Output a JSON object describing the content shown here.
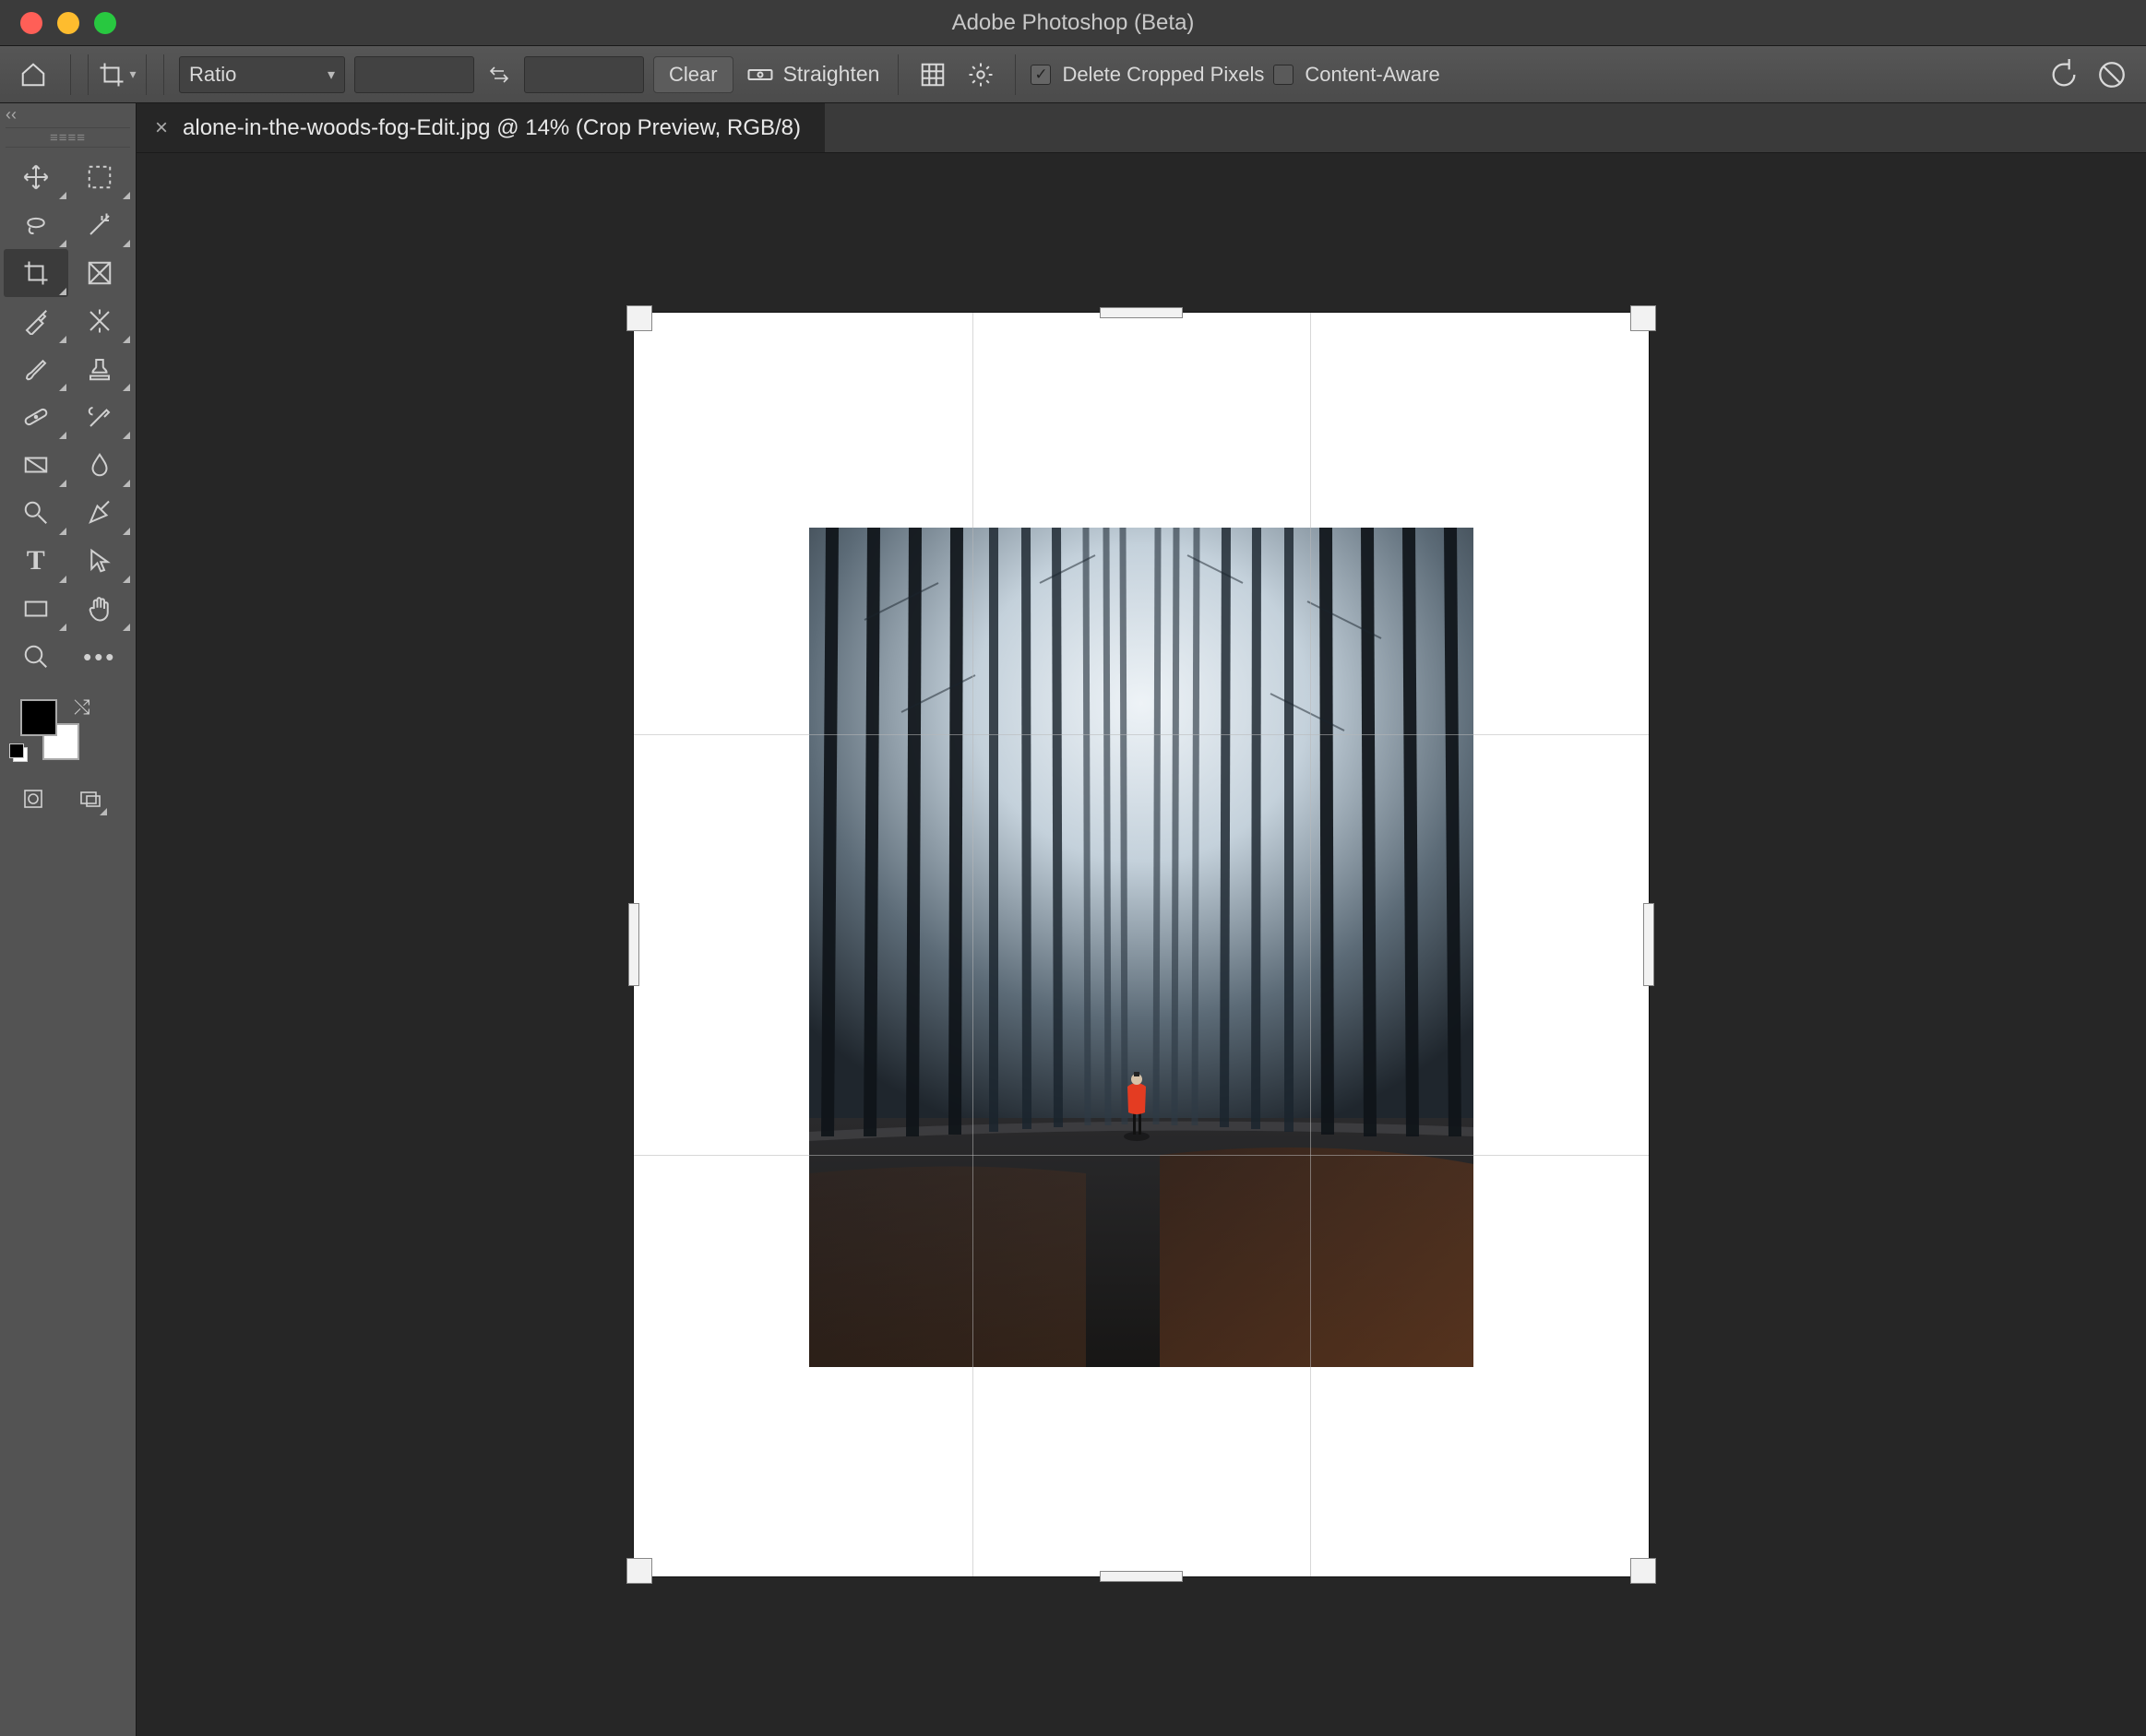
{
  "app_title": "Adobe Photoshop (Beta)",
  "options": {
    "ratio_label": "Ratio",
    "width_value": "",
    "height_value": "",
    "clear_label": "Clear",
    "straighten_label": "Straighten",
    "delete_cropped_label": "Delete Cropped Pixels",
    "delete_cropped_checked": true,
    "content_aware_label": "Content-Aware",
    "content_aware_checked": false
  },
  "document": {
    "tab_title": "alone-in-the-woods-fog-Edit.jpg @ 14% (Crop Preview, RGB/8)"
  },
  "tools": {
    "left": [
      "move-tool",
      "marquee-tool",
      "lasso-tool",
      "magic-wand-tool",
      "crop-tool",
      "frame-tool",
      "eyedropper-tool",
      "generative-fill-tool",
      "brush-tool",
      "clone-stamp-tool",
      "healing-brush-tool",
      "history-brush-tool",
      "gradient-tool",
      "blur-tool",
      "dodge-tool",
      "pen-tool",
      "type-tool",
      "path-select-tool",
      "rectangle-tool",
      "hand-tool",
      "zoom-tool",
      "more-tools"
    ],
    "active": "crop-tool"
  },
  "swatches": {
    "foreground": "#000000",
    "background": "#ffffff"
  }
}
